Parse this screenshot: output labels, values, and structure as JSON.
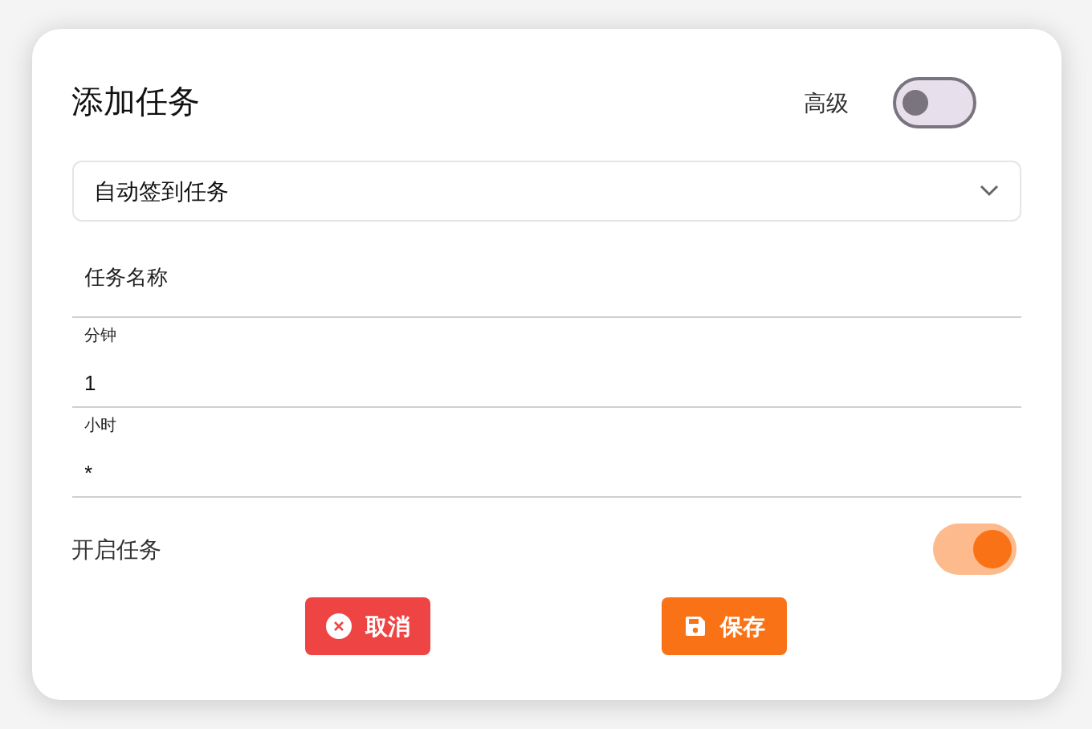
{
  "dialog": {
    "title": "添加任务",
    "advanced": {
      "label": "高级",
      "on": false
    }
  },
  "task_type": {
    "value": "自动签到任务"
  },
  "fields": [
    {
      "placeholder": "任务名称"
    },
    {
      "label": "分钟",
      "value": "1"
    },
    {
      "label": "小时",
      "value": "*"
    }
  ],
  "enable": {
    "label": "开启任务",
    "on": true
  },
  "buttons": [
    {
      "kind": "cancel",
      "label": "取消"
    },
    {
      "kind": "save",
      "label": "保存"
    }
  ]
}
